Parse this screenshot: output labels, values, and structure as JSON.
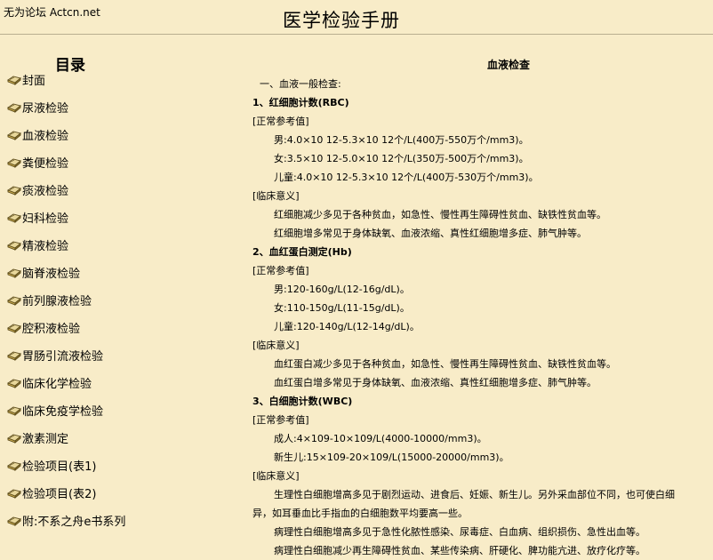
{
  "header": {
    "site_name": "无为论坛 Actcn.net",
    "doc_title": "医学检验手册"
  },
  "toc": {
    "title": "目录",
    "items": [
      "封面",
      "尿液检验",
      "血液检验",
      "粪便检验",
      "痰液检验",
      "妇科检验",
      "精液检验",
      "脑脊液检验",
      "前列腺液检验",
      "腔积液检验",
      "胃肠引流液检验",
      "临床化学检验",
      "临床免疫学检验",
      "激素测定",
      "检验项目(表1)",
      "检验项目(表2)",
      "附:不系之舟e书系列"
    ]
  },
  "content": {
    "section_title": "血液检查",
    "lines": [
      {
        "text": "一、血液一般检查:",
        "indent": 1,
        "bold": false
      },
      {
        "text": "1、红细胞计数(RBC)",
        "indent": 0,
        "bold": true
      },
      {
        "text": "[正常参考值]",
        "indent": 0,
        "bold": false
      },
      {
        "text": "男:4.0×10 12-5.3×10 12个/L(400万-550万个/mm3)。",
        "indent": 2,
        "bold": false
      },
      {
        "text": "女:3.5×10 12-5.0×10 12个/L(350万-500万个/mm3)。",
        "indent": 2,
        "bold": false
      },
      {
        "text": "儿童:4.0×10 12-5.3×10 12个/L(400万-530万个/mm3)。",
        "indent": 2,
        "bold": false
      },
      {
        "text": "[临床意义]",
        "indent": 0,
        "bold": false
      },
      {
        "text": "红细胞减少多见于各种贫血，如急性、慢性再生障碍性贫血、缺铁性贫血等。",
        "indent": 2,
        "bold": false
      },
      {
        "text": "红细胞增多常见于身体缺氧、血液浓缩、真性红细胞增多症、肺气肿等。",
        "indent": 2,
        "bold": false
      },
      {
        "text": "2、血红蛋白测定(Hb)",
        "indent": 0,
        "bold": true
      },
      {
        "text": "[正常参考值]",
        "indent": 0,
        "bold": false
      },
      {
        "text": "男:120-160g/L(12-16g/dL)。",
        "indent": 2,
        "bold": false
      },
      {
        "text": "女:110-150g/L(11-15g/dL)。",
        "indent": 2,
        "bold": false
      },
      {
        "text": "儿童:120-140g/L(12-14g/dL)。",
        "indent": 2,
        "bold": false
      },
      {
        "text": "[临床意义]",
        "indent": 0,
        "bold": false
      },
      {
        "text": "血红蛋白减少多见于各种贫血，如急性、慢性再生障碍性贫血、缺铁性贫血等。",
        "indent": 2,
        "bold": false
      },
      {
        "text": "血红蛋白增多常见于身体缺氧、血液浓缩、真性红细胞增多症、肺气肿等。",
        "indent": 2,
        "bold": false
      },
      {
        "text": "3、白细胞计数(WBC)",
        "indent": 0,
        "bold": true
      },
      {
        "text": "[正常参考值]",
        "indent": 0,
        "bold": false
      },
      {
        "text": "成人:4×109-10×109/L(4000-10000/mm3)。",
        "indent": 2,
        "bold": false
      },
      {
        "text": "新生儿:15×109-20×109/L(15000-20000/mm3)。",
        "indent": 2,
        "bold": false
      },
      {
        "text": "[临床意义]",
        "indent": 0,
        "bold": false
      },
      {
        "text": "生理性白细胞增高多见于剧烈运动、进食后、妊娠、新生儿。另外采血部位不同，也可使白细",
        "indent": 2,
        "bold": false
      },
      {
        "text": "异，如耳垂血比手指血的白细胞数平均要高一些。",
        "indent": 0,
        "bold": false
      },
      {
        "text": "病理性白细胞增高多见于急性化脓性感染、尿毒症、白血病、组织损伤、急性出血等。",
        "indent": 2,
        "bold": false
      },
      {
        "text": "病理性白细胞减少再生障碍性贫血、某些传染病、肝硬化、脾功能亢进、放疗化疗等。",
        "indent": 2,
        "bold": false
      }
    ]
  }
}
